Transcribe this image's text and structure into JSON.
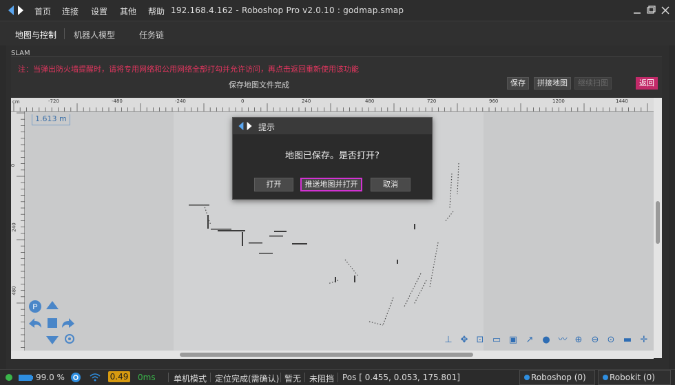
{
  "titlebar": {
    "menu": [
      "首页",
      "连接",
      "设置",
      "其他",
      "帮助"
    ],
    "title": "192.168.4.162 - Roboshop Pro v2.0.10 : godmap.smap",
    "controls": [
      "minimize-icon",
      "maximize-icon",
      "close-icon"
    ]
  },
  "tabs": [
    "地图与控制",
    "机器人模型",
    "任务链"
  ],
  "slam": {
    "header": "SLAM",
    "notice": "注：当弹出防火墙提醒时，请将专用网络和公用网络全部打勾并允许访问，再点击返回重新使用该功能",
    "status": "保存地图文件完成",
    "buttons": {
      "save": "保存",
      "stitch": "拼接地图",
      "disabled": "继续扫图",
      "back": "返回"
    }
  },
  "map": {
    "ruler_unit": "cm",
    "ruler_top": [
      "-720",
      "-480",
      "-240",
      "0",
      "240",
      "480",
      "720",
      "960",
      "1200",
      "1440"
    ],
    "ruler_left": [
      "0",
      "240",
      "480"
    ],
    "scale": "1.613 m",
    "nav_icons": [
      "p-icon",
      "arrow-up-icon",
      "arrow-left-icon",
      "stop-icon",
      "arrow-right-icon",
      "arrow-down-icon",
      "settings-icon"
    ],
    "tools": [
      "anchor-icon",
      "move-icon",
      "select-icon",
      "frame-icon",
      "image-icon",
      "export-icon",
      "o-icon",
      "wave-icon",
      "zoom-in-icon",
      "zoom-out-icon",
      "zoom-fit-icon",
      "layer-icon",
      "fullscreen-icon"
    ]
  },
  "dialog": {
    "title": "提示",
    "message": "地图已保存。是否打开?",
    "buttons": {
      "open": "打开",
      "push_open": "推送地图并打开",
      "cancel": "取消"
    }
  },
  "statusbar": {
    "battery": "99.0 %",
    "badge": "0.49",
    "latency": "0ms",
    "mode": "单机模式",
    "localization": "定位完成(需确认)",
    "alarm": "暂无",
    "block": "未阻挡",
    "pos": "Pos [ 0.455, 0.053, 175.801]",
    "roboshop": "Roboshop (0)",
    "robokit": "Robokit (0)"
  },
  "colors": {
    "accent": "#c22a69",
    "notice": "#e2365f",
    "badge": "#d79a10",
    "link": "#2e6db4"
  }
}
